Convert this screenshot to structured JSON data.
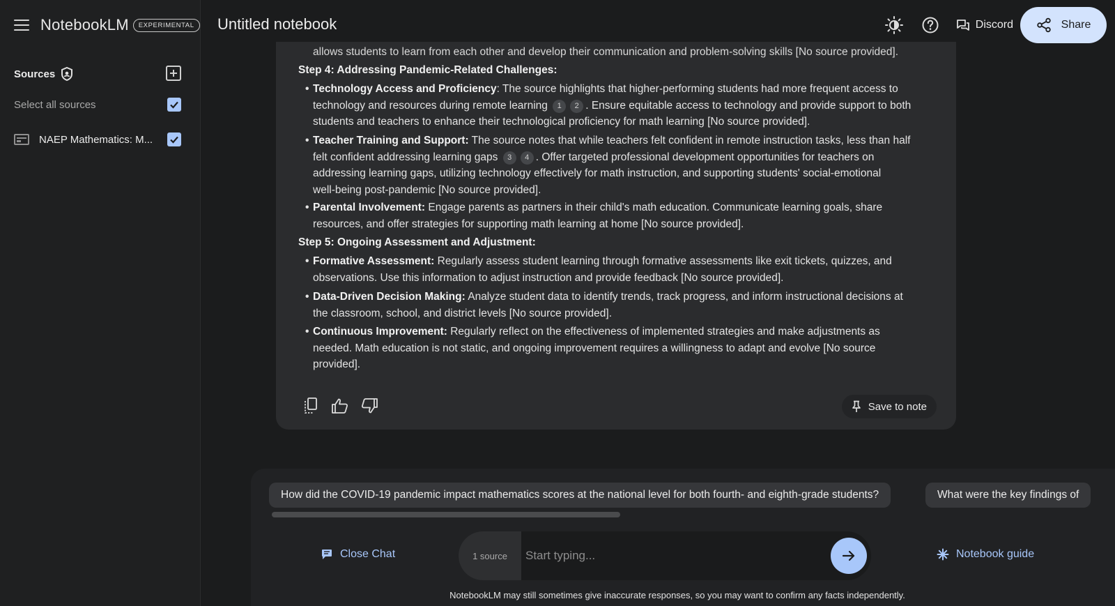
{
  "app": {
    "name": "NotebookLM",
    "badge": "EXPERIMENTAL"
  },
  "notebook": {
    "title": "Untitled notebook"
  },
  "header": {
    "discord_label": "Discord",
    "share_label": "Share"
  },
  "sidebar": {
    "sources_label": "Sources",
    "select_all_label": "Select all sources",
    "select_all_checked": true,
    "sources": [
      {
        "name": "NAEP Mathematics: M...",
        "checked": true
      }
    ]
  },
  "response": {
    "clipped_line": "allows students to learn from each other and develop their communication and problem-solving skills [No source provided].",
    "step4": {
      "heading": "Step 4: Addressing Pandemic-Related Challenges:",
      "b1": {
        "title": "Technology Access and Proficiency",
        "l1": ": The source highlights that higher-performing students had more frequent access to",
        "l2a": "technology and resources during remote learning",
        "c1": "1",
        "c2": "2",
        "l2b": ". Ensure equitable access to technology and provide support to both",
        "l3": "students and teachers to enhance their technological proficiency for math learning [No source provided]."
      },
      "b2": {
        "title": "Teacher Training and Support:",
        "l1": " The source notes that while teachers felt confident in remote instruction tasks, less than half",
        "l2a": "felt confident addressing learning gaps",
        "c1": "3",
        "c2": "4",
        "l2b": ". Offer targeted professional development opportunities for teachers on",
        "l3": "addressing learning gaps, utilizing technology effectively for math instruction, and supporting students' social-emotional",
        "l4": "well-being post-pandemic [No source provided]."
      },
      "b3": {
        "title": "Parental Involvement:",
        "l1": " Engage parents as partners in their child's math education. Communicate learning goals, share",
        "l2": "resources, and offer strategies for supporting math learning at home [No source provided]."
      }
    },
    "step5": {
      "heading": "Step 5: Ongoing Assessment and Adjustment:",
      "b1": {
        "title": "Formative Assessment:",
        "l1": " Regularly assess student learning through formative assessments like exit tickets, quizzes, and",
        "l2": "observations. Use this information to adjust instruction and provide feedback [No source provided]."
      },
      "b2": {
        "title": "Data-Driven Decision Making:",
        "l1": " Analyze student data to identify trends, track progress, and inform instructional decisions at",
        "l2": "the classroom, school, and district levels [No source provided]."
      },
      "b3": {
        "title": "Continuous Improvement:",
        "l1": " Regularly reflect on the effectiveness of implemented strategies and make adjustments as",
        "l2": "needed. Math education is not static, and ongoing improvement requires a willingness to adapt and evolve [No source",
        "l3": "provided]."
      }
    },
    "save_to_note_label": "Save to note"
  },
  "chat": {
    "suggestions": [
      "How did the COVID-19 pandemic impact mathematics scores at the national level for both fourth- and eighth-grade students?",
      "What were the key findings of"
    ],
    "close_chat_label": "Close Chat",
    "source_count_label": "1 source",
    "input_placeholder": "Start typing...",
    "notebook_guide_label": "Notebook guide",
    "disclaimer": "NotebookLM may still sometimes give inaccurate responses, so you may want to confirm any facts independently."
  },
  "colors": {
    "accent": "#a8c7fa",
    "share_bg": "#d3e3fd",
    "background": "#1b1c1d",
    "card": "#2b2c2e"
  }
}
